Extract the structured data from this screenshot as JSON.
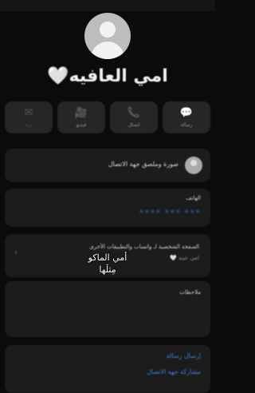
{
  "contact": {
    "name": "امي العافيه🤍"
  },
  "actions": [
    {
      "icon": "message-icon",
      "glyph": "💬",
      "label": "رسالة",
      "enabled": true
    },
    {
      "icon": "phone-icon",
      "glyph": "📞",
      "label": "اتصال",
      "enabled": true
    },
    {
      "icon": "video-icon",
      "glyph": "🎥",
      "label": "فيديو",
      "enabled": true
    },
    {
      "icon": "mail-icon",
      "glyph": "✉",
      "label": "بريد",
      "enabled": false
    }
  ],
  "contact_card": {
    "text": "صورة وملصق جهة الاتصال"
  },
  "phone": {
    "label": "الهاتف",
    "number": "•••• ••• •••"
  },
  "status": {
    "line1": "الصفحة الشخصية لـ واتساب والتطبيقات الأخرى",
    "line2": "امي عينه 🤍"
  },
  "notes": {
    "label": "ملاحظات"
  },
  "links": {
    "send_message": "إرسال رسالة",
    "share_contact": "مشاركة جهة الاتصال"
  },
  "overlay": {
    "line1": "أمي الماكو",
    "line2": "مِثلَها"
  }
}
